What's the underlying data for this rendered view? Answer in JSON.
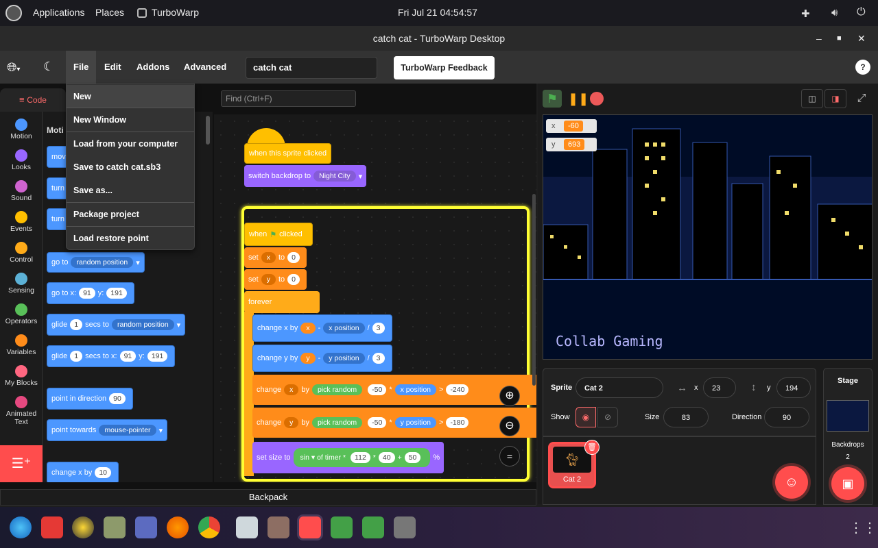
{
  "system_bar": {
    "applications": "Applications",
    "places": "Places",
    "app": "TurboWarp",
    "clock": "Fri Jul 21  04:54:57"
  },
  "window": {
    "title": "catch cat - TurboWarp Desktop"
  },
  "menubar": {
    "file": "File",
    "edit": "Edit",
    "addons": "Addons",
    "advanced": "Advanced",
    "project_title": "catch cat",
    "feedback": "TurboWarp Feedback",
    "help": "?"
  },
  "file_menu": {
    "items": [
      "New",
      "New Window",
      "Load from your computer",
      "Save to catch cat.sb3",
      "Save as...",
      "Package project",
      "Load restore point"
    ]
  },
  "tabs": {
    "code": "Code"
  },
  "find": {
    "placeholder": "Find (Ctrl+F)"
  },
  "categories": [
    {
      "label": "Motion",
      "color": "#4c97ff"
    },
    {
      "label": "Looks",
      "color": "#9966ff"
    },
    {
      "label": "Sound",
      "color": "#cf63cf"
    },
    {
      "label": "Events",
      "color": "#ffbf00"
    },
    {
      "label": "Control",
      "color": "#ffab19"
    },
    {
      "label": "Sensing",
      "color": "#5cb1d6"
    },
    {
      "label": "Operators",
      "color": "#59c059"
    },
    {
      "label": "Variables",
      "color": "#ff8c1a"
    },
    {
      "label": "My Blocks",
      "color": "#ff6680"
    },
    {
      "label": "Animated Text",
      "color": "#e64980"
    }
  ],
  "palette": {
    "heading": "Moti",
    "b_move": "move",
    "b_turn1": "turn",
    "b_turn2": "turn",
    "goto": "go to",
    "goto_val": "random position",
    "gotoxy": "go to x:",
    "gotoxy_x": "91",
    "y": "y:",
    "gotoxy_y": "191",
    "glide": "glide",
    "glide_secs": "1",
    "secs_to": "secs to",
    "glide_to": "random position",
    "glide2": "glide",
    "glide2_secs": "1",
    "secs_to_x": "secs to x:",
    "glide2_x": "91",
    "glide2_y": "191",
    "point_dir": "point in direction",
    "point_dir_val": "90",
    "point_towards": "point towards",
    "point_towards_val": "mouse-pointer",
    "change_x": "change x by",
    "change_x_val": "10"
  },
  "script": {
    "hat1": "when this sprite clicked",
    "switch_backdrop": "switch backdrop to",
    "backdrop_val": "Night City",
    "when": "when",
    "clicked": "clicked",
    "set": "set",
    "to": "to",
    "var_x": "x",
    "var_y": "y",
    "zero": "0",
    "forever": "forever",
    "change_x_by": "change x by",
    "change_y_by": "change y by",
    "x_var": "x",
    "minus": "-",
    "x_position": "x position",
    "div": "/",
    "three": "3",
    "y_var": "y",
    "y_position": "y position",
    "change": "change",
    "by": "by",
    "pick_random": "pick random",
    "neg50": "-50",
    "star": "*",
    "gt": ">",
    "neg240": "-240",
    "neg180": "-180",
    "fifty_cut": "50",
    "set_size_to": "set size to",
    "sin": "sin",
    "of": "of",
    "timer": "timer",
    "n112": "112",
    "n40": "40",
    "plus": "+",
    "n50": "50",
    "percent": "%"
  },
  "zoom": {
    "eq": "="
  },
  "stage": {
    "x_label": "x",
    "x_val": "-60",
    "y_label": "y",
    "y_val": "693",
    "watermark": "Collab Gaming"
  },
  "sprite_info": {
    "sprite_label": "Sprite",
    "sprite_name": "Cat 2",
    "x_label": "x",
    "x_val": "23",
    "y_label": "y",
    "y_val": "194",
    "show_label": "Show",
    "size_label": "Size",
    "size_val": "83",
    "direction_label": "Direction",
    "direction_val": "90"
  },
  "sprite_list": {
    "sprite1": "Cat 2"
  },
  "stage_panel": {
    "title": "Stage",
    "backdrops_label": "Backdrops",
    "backdrops_count": "2"
  },
  "backpack": {
    "label": "Backpack"
  }
}
